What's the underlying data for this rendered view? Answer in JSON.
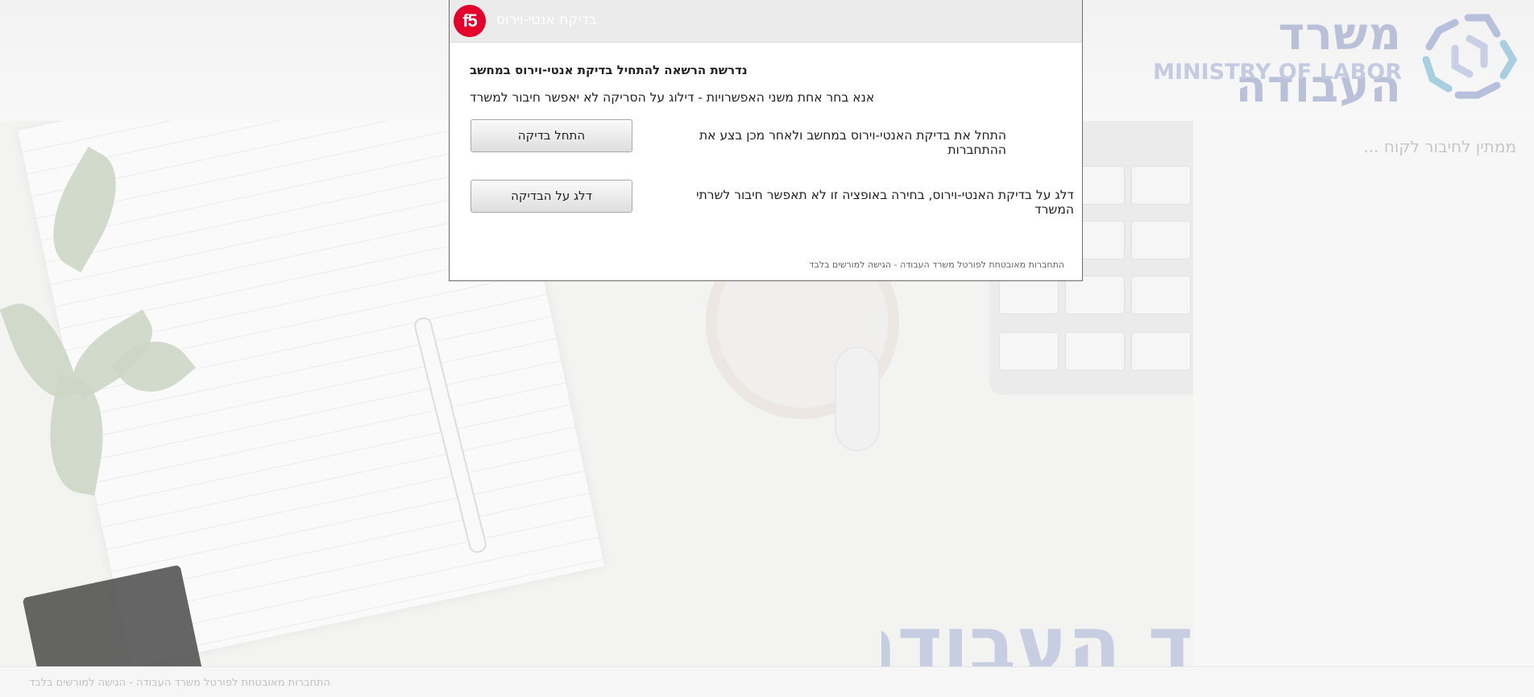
{
  "background": {
    "logo": {
      "hebrew": "משרד העבודה",
      "english": "MINISTRY OF LABOR"
    },
    "waiting_text": "ממתין לחיבור לקוח ...",
    "watermark": "ד העבודה",
    "footer_text": "התחברות מאובטחת לפורטל משרד העבודה - הגישה למורשים בלבד"
  },
  "dialog": {
    "logo_text": "f5",
    "title": "בדיקת אנטי-וירוס",
    "heading": "נדרשת הרשאה להתחיל בדיקת אנטי-וירוס במחשב",
    "instruction": "אנא בחר אחת משני האפשרויות - דילוג על הסריקה לא יאפשר חיבור למשרד",
    "options": [
      {
        "button_label": "התחל בדיקה",
        "description": "התחל את בדיקת האנטי-וירוס במחשב ולאחר מכן בצע את ההתחברות"
      },
      {
        "button_label": "דלג על הבדיקה",
        "description": "דלג על בדיקת האנטי-וירוס, בחירה באופציה זו לא תאפשר חיבור לשרתי המשרד"
      }
    ],
    "footer": "התחברות מאובטחת לפורטל משרד העבודה - הגישה למורשים בלבד"
  },
  "colors": {
    "f5_red": "#e4002b",
    "logo_blue": "#b9c0d8",
    "dialog_title_bar": "#ebebeb"
  }
}
